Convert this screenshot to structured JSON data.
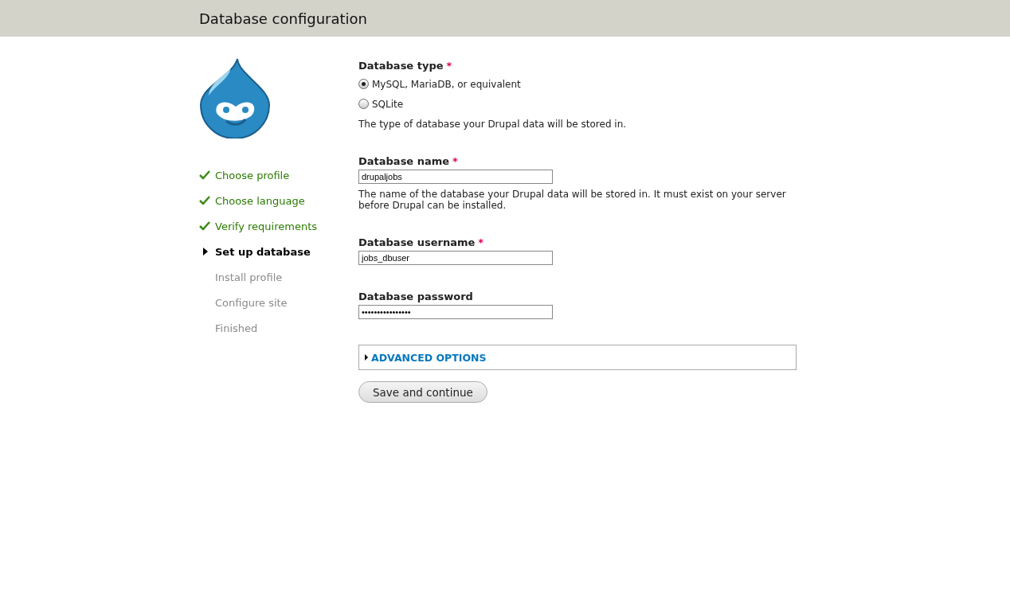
{
  "header": {
    "title": "Database configuration"
  },
  "steps": [
    {
      "label": "Choose profile",
      "completed": true,
      "selected": false
    },
    {
      "label": "Choose language",
      "completed": true,
      "selected": false
    },
    {
      "label": "Verify requirements",
      "completed": true,
      "selected": false
    },
    {
      "label": "Set up database",
      "completed": false,
      "selected": true
    },
    {
      "label": "Install profile",
      "completed": false,
      "selected": false
    },
    {
      "label": "Configure site",
      "completed": false,
      "selected": false
    },
    {
      "label": "Finished",
      "completed": false,
      "selected": false
    }
  ],
  "database_type": {
    "label": "Database type",
    "required_mark": "*",
    "options": [
      {
        "label": "MySQL, MariaDB, or equivalent",
        "selected": true
      },
      {
        "label": "SQLite",
        "selected": false
      }
    ],
    "description": "The type of database your Drupal data will be stored in."
  },
  "fields": [
    {
      "label": "Database name",
      "required_mark": "*",
      "value": "drupaljobs",
      "description": "The name of the database your Drupal data will be stored in. It must exist on your server before Drupal can be installed."
    },
    {
      "label": "Database username",
      "required_mark": "*",
      "value": "jobs_dbuser"
    },
    {
      "label": "Database password",
      "value": "••••••••••••••••"
    }
  ],
  "advanced": {
    "label": "ADVANCED OPTIONS",
    "expanded": false
  },
  "submit": {
    "label": "Save and continue"
  }
}
